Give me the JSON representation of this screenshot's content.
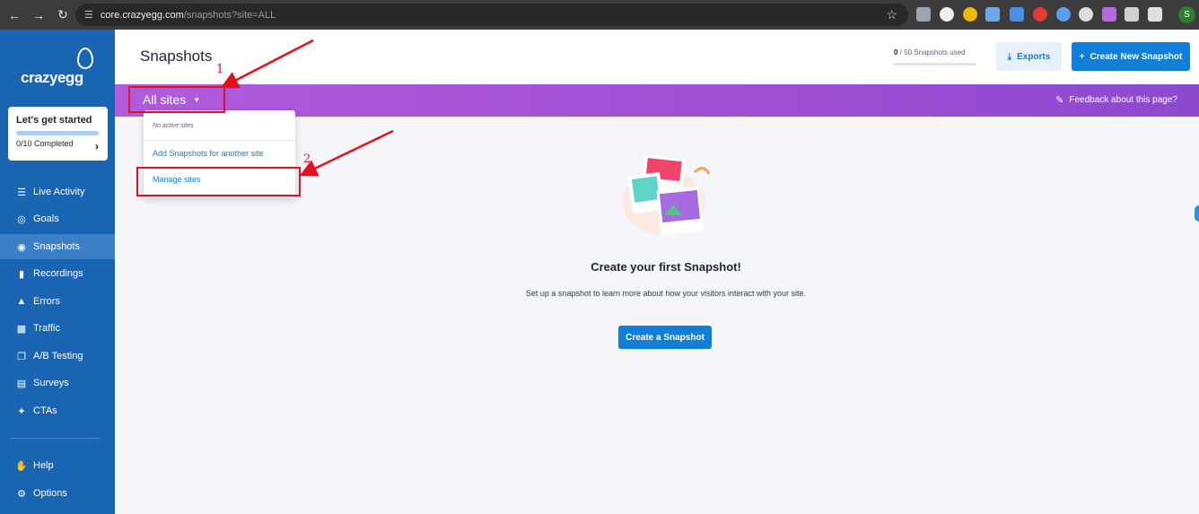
{
  "browser": {
    "url_host": "core.crazyegg.com",
    "url_path": "/snapshots?site=ALL",
    "profile_initial": "S"
  },
  "sidebar": {
    "logo": "crazyegg",
    "started": {
      "title": "Let's get started",
      "count": "0/10 Completed",
      "progress": 0
    },
    "items": [
      {
        "label": "Live Activity",
        "icon": "list-icon"
      },
      {
        "label": "Goals",
        "icon": "target-icon"
      },
      {
        "label": "Snapshots",
        "icon": "camera-icon",
        "active": true
      },
      {
        "label": "Recordings",
        "icon": "video-icon"
      },
      {
        "label": "Errors",
        "icon": "warning-icon"
      },
      {
        "label": "Traffic",
        "icon": "bar-chart-icon"
      },
      {
        "label": "A/B Testing",
        "icon": "copy-icon"
      },
      {
        "label": "Surveys",
        "icon": "clipboard-icon"
      },
      {
        "label": "CTAs",
        "icon": "sparkle-icon"
      }
    ],
    "bottom": [
      {
        "label": "Help",
        "icon": "hand-icon"
      },
      {
        "label": "Options",
        "icon": "gear-icon"
      }
    ]
  },
  "header": {
    "title": "Snapshots",
    "usage_used": "0",
    "usage_rest": " / 50 Snapshots used",
    "exports": "Exports",
    "create": "Create New Snapshot"
  },
  "toolbar": {
    "site_select": "All sites",
    "feedback": "Feedback about this page?"
  },
  "dropdown": {
    "no_active": "No active sites",
    "add": "Add Snapshots for another site",
    "manage": "Manage sites"
  },
  "annotations": {
    "label1": "1",
    "label2": "2"
  },
  "empty": {
    "title": "Create your first Snapshot!",
    "subtitle": "Set up a snapshot to learn more about how your visitors interact with your site.",
    "button": "Create a Snapshot"
  },
  "colors": {
    "accent": "#0f7fd9",
    "sidebar": "#1a64b4",
    "banner": "#a653d8",
    "annotation": "#e5101d"
  }
}
